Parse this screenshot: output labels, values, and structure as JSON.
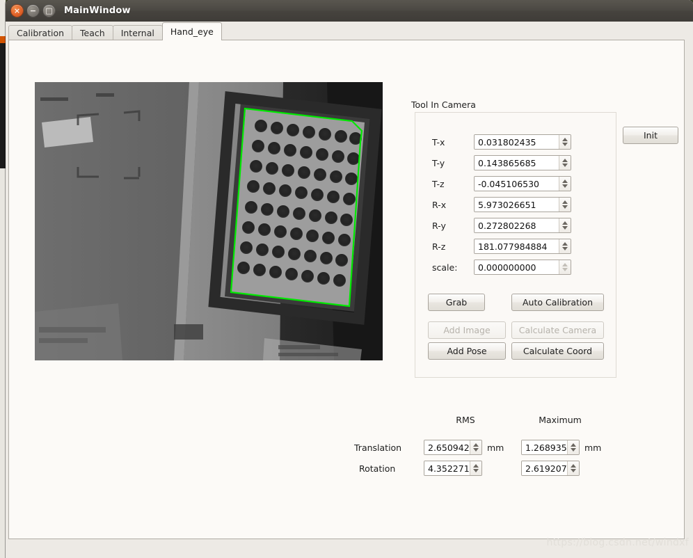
{
  "window": {
    "title": "MainWindow",
    "controls": {
      "close": "×",
      "minimize": "−",
      "maximize": "□"
    }
  },
  "tabs": [
    {
      "label": "Calibration",
      "active": false
    },
    {
      "label": "Teach",
      "active": false
    },
    {
      "label": "Internal",
      "active": false
    },
    {
      "label": "Hand_eye",
      "active": true
    }
  ],
  "group": {
    "title": "Tool In Camera",
    "fields": [
      {
        "label": "T-x",
        "value": "0.031802435",
        "enabled": true
      },
      {
        "label": "T-y",
        "value": "0.143865685",
        "enabled": true
      },
      {
        "label": "T-z",
        "value": "-0.045106530",
        "enabled": true
      },
      {
        "label": "R-x",
        "value": "5.973026651",
        "enabled": true
      },
      {
        "label": "R-y",
        "value": "0.272802268",
        "enabled": true
      },
      {
        "label": "R-z",
        "value": "181.077984884",
        "enabled": true
      },
      {
        "label": "scale:",
        "value": "0.000000000",
        "enabled": false
      }
    ],
    "buttons": [
      {
        "label": "Grab",
        "enabled": true
      },
      {
        "label": "Auto Calibration",
        "enabled": true
      },
      {
        "label": "Add Image",
        "enabled": false
      },
      {
        "label": "Calculate Camera",
        "enabled": false
      },
      {
        "label": "Add Pose",
        "enabled": true
      },
      {
        "label": "Calculate Coord",
        "enabled": true
      }
    ]
  },
  "init_button": {
    "label": "Init"
  },
  "stats": {
    "columns": [
      "RMS",
      "Maximum"
    ],
    "rows": [
      {
        "label": "Translation",
        "rms": "2.6509423",
        "rms_unit": "mm",
        "max": "1.26893544",
        "max_unit": "mm"
      },
      {
        "label": "Rotation",
        "rms": "4.3522715",
        "rms_unit": "",
        "max": "2.6192077",
        "max_unit": ""
      }
    ]
  },
  "camera": {
    "overlay_color": "#00e800",
    "description": "grayscale camera view of dot calibration target with detected green contour",
    "grid_rows": 7,
    "grid_cols": 7
  },
  "watermark": "https://blog.csdn.net/windxf"
}
